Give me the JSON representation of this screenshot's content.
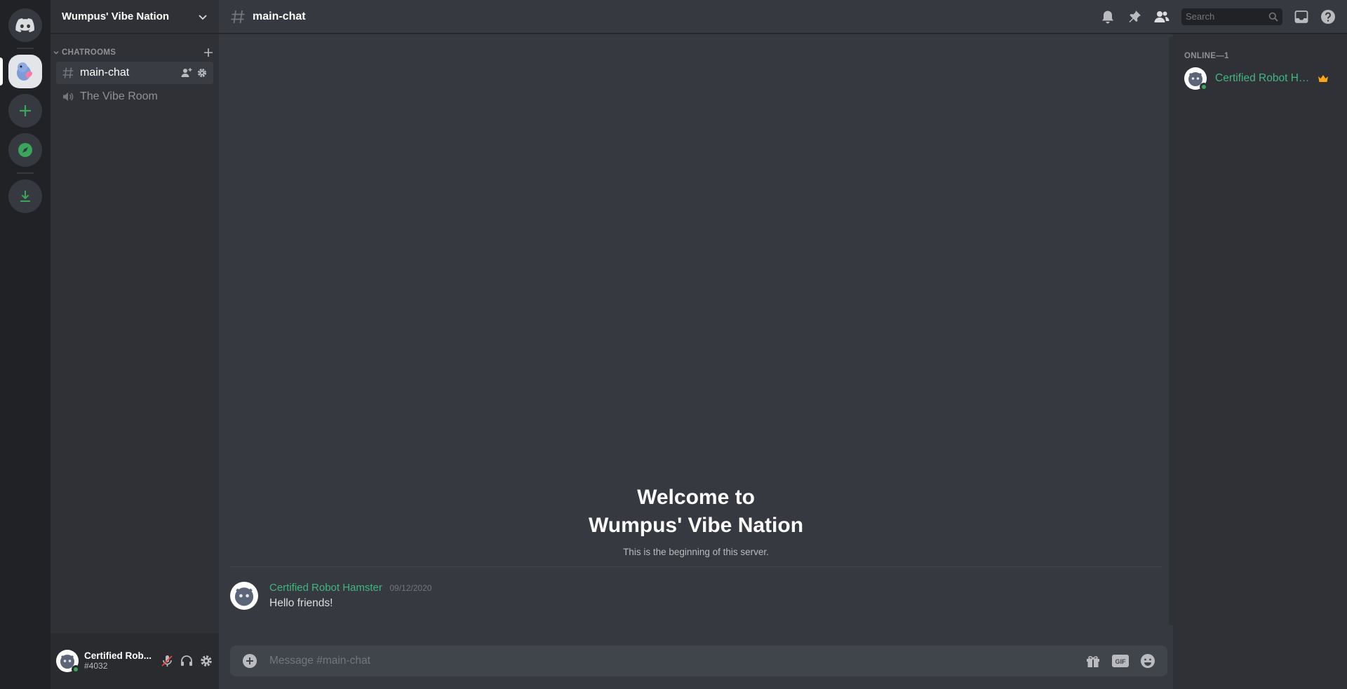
{
  "server": {
    "name": "Wumpus' Vibe Nation",
    "category": "CHATROOMS",
    "channels": [
      {
        "name": "main-chat",
        "type": "text",
        "active": true
      },
      {
        "name": "The Vibe Room",
        "type": "voice",
        "active": false
      }
    ]
  },
  "user": {
    "name": "Certified Rob...",
    "tag": "#4032"
  },
  "topbar": {
    "channel_name": "main-chat",
    "search_placeholder": "Search"
  },
  "welcome": {
    "line1": "Welcome to",
    "line2": "Wumpus' Vibe Nation",
    "subtitle": "This is the beginning of this server."
  },
  "messages": [
    {
      "author": "Certified Robot Hamster",
      "timestamp": "09/12/2020",
      "content": "Hello friends!"
    }
  ],
  "composer": {
    "placeholder": "Message #main-chat",
    "gif_label": "GIF"
  },
  "members": {
    "header": "ONLINE—1",
    "list": [
      {
        "name": "Certified Robot Ha...",
        "status": "online",
        "owner": true
      }
    ]
  },
  "colors": {
    "accent_green": "#43b581",
    "online": "#3ba55d",
    "crown": "#faa61a"
  }
}
